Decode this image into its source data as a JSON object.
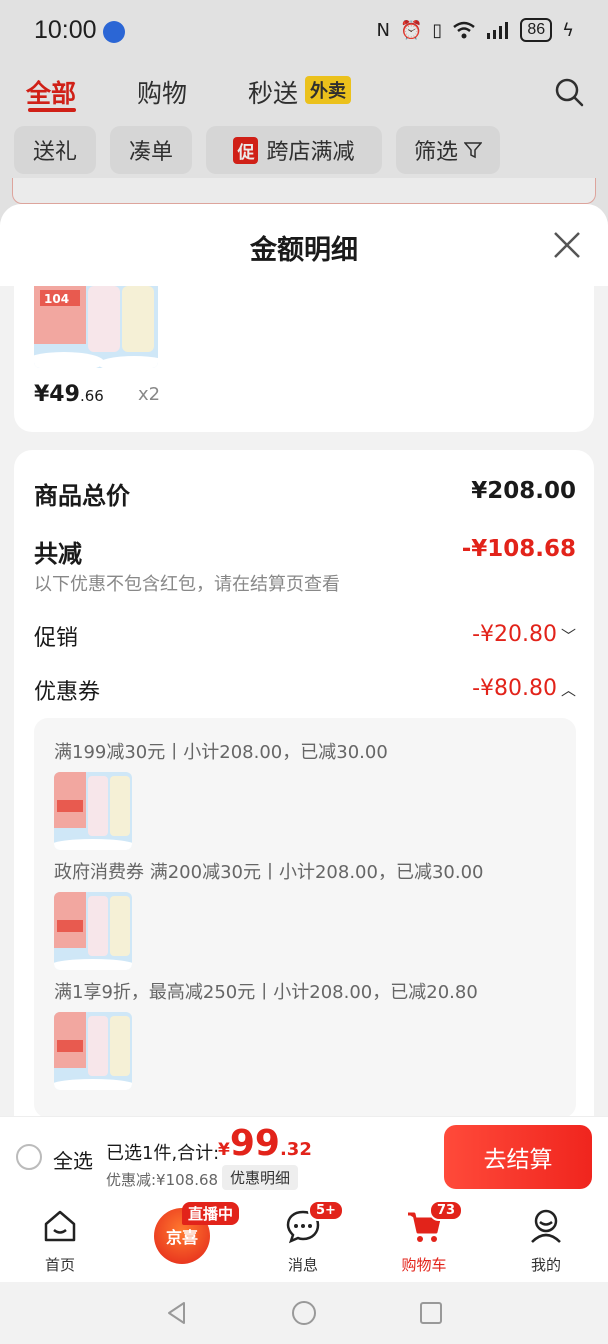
{
  "status_bar": {
    "time": "10:00",
    "battery": "86"
  },
  "top_tabs": {
    "all": "全部",
    "shopping": "购物",
    "flash": "秒送",
    "waimai": "外卖"
  },
  "filters": {
    "gift": "送礼",
    "combine": "凑单",
    "promo_tag": "促",
    "cross_store": "跨店满减",
    "filter": "筛选"
  },
  "sheet": {
    "title": "金额明细",
    "product": {
      "price_int": "¥49",
      "price_dec": ".66",
      "qty": "x2",
      "pack_label": "104"
    },
    "detail": {
      "total_label": "商品总价",
      "total_value": "¥208.00",
      "reduce_label": "共减",
      "reduce_value": "-¥108.68",
      "note": "以下优惠不包含红包，请在结算页查看",
      "promo_label": "促销",
      "promo_value": "-¥20.80",
      "coupon_label": "优惠券",
      "coupon_value": "-¥80.80"
    },
    "coupons": [
      {
        "text": "满199减30元丨小计208.00，已减30.00"
      },
      {
        "text": "政府消费券 满200减30元丨小计208.00，已减30.00"
      },
      {
        "text": "满1享9折，最高减250元丨小计208.00，已减20.80"
      }
    ]
  },
  "checkout": {
    "select_all": "全选",
    "selected": "已选1件,合计:",
    "currency": "¥",
    "total_int": "99",
    "total_dec": ".32",
    "discount": "优惠减:¥108.68",
    "detail_link": "优惠明细",
    "button": "去结算"
  },
  "nav": {
    "home": "首页",
    "jingxi": "京喜",
    "live": "直播中",
    "messages": "消息",
    "messages_badge": "5+",
    "cart": "购物车",
    "cart_badge": "73",
    "mine": "我的"
  },
  "colors": {
    "accent": "#e2231a",
    "waimai_yellow": "#ffd21f"
  }
}
